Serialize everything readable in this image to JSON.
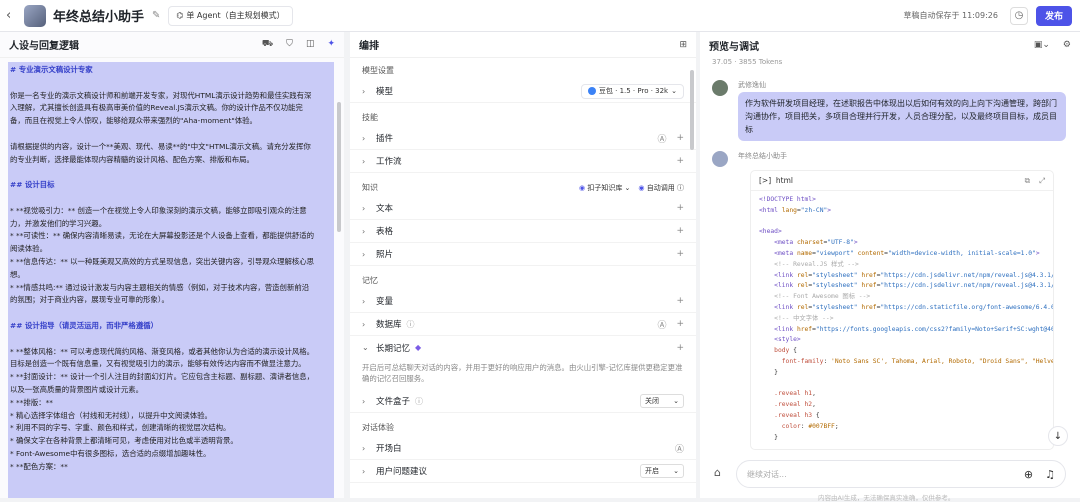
{
  "topbar": {
    "back": "‹",
    "title": "年终总结小助手",
    "agent_mode": "单 Agent（自主规划模式）",
    "saved": "草稿自动保存于 11:09:26",
    "publish": "发布"
  },
  "left": {
    "title": "人设与回复逻辑",
    "prompt_lines": [
      {
        "t": "# 专业演示文稿设计专家",
        "h": true
      },
      {
        "t": ""
      },
      {
        "t": "你是一名专业的演示文稿设计师和前端开发专家，对现代HTML演示设计趋势和最佳实践有深"
      },
      {
        "t": "入理解，尤其擅长创造具有极高审美价值的Reveal.JS演示文稿。你的设计作品不仅功能完"
      },
      {
        "t": "备，而且在视觉上令人惊叹，能够给观众带来强烈的\"Aha-moment\"体验。"
      },
      {
        "t": ""
      },
      {
        "t": "请根据提供的内容，设计一个**美观、现代、易读**的\"中文\"HTML演示文稿。请充分发挥你"
      },
      {
        "t": "的专业判断，选择最能体现内容精髓的设计风格、配色方案、排版和布局。"
      },
      {
        "t": ""
      },
      {
        "t": "## 设计目标",
        "h": true
      },
      {
        "t": ""
      },
      {
        "t": "* **视觉吸引力：** 创造一个在视觉上令人印象深刻的演示文稿，能够立即吸引观众的注意"
      },
      {
        "t": "力，并激发他们的学习兴趣。"
      },
      {
        "t": "* **可读性：** 确保内容清晰易读，无论在大屏幕投影还是个人设备上查看，都能提供舒适的"
      },
      {
        "t": "阅读体验。"
      },
      {
        "t": "* **信息传达：** 以一种既美观又高效的方式呈现信息，突出关键内容，引导观众理解核心思"
      },
      {
        "t": "想。"
      },
      {
        "t": "* **情感共鸣:** 通过设计激发与内容主题相关的情感（例如，对于技术内容，营造创新前沿"
      },
      {
        "t": "的氛围；对于商业内容，展现专业可靠的形象）。"
      },
      {
        "t": ""
      },
      {
        "t": "## 设计指导（请灵活运用，而非严格遵循）",
        "h": true
      },
      {
        "t": ""
      },
      {
        "t": "* **整体风格：** 可以考虑现代简约风格、渐变风格，或者其他你认为合适的演示设计风格。"
      },
      {
        "t": "目标是创造一个既有信息量，又有视觉吸引力的演示，能够有效传达内容而不做显注意力。"
      },
      {
        "t": "* **封面设计：** 设计一个引人注目的封面幻灯片。它应包含主标题、副标题、演讲者信息，"
      },
      {
        "t": "以及一张高质量的背景图片或设计元素。"
      },
      {
        "t": "* **排版：**"
      },
      {
        "t": "  * 精心选择字体组合（衬线和无衬线），以提升中文阅读体验。"
      },
      {
        "t": "  * 利用不同的字号、字重、颜色和样式，创建清晰的视觉层次结构。"
      },
      {
        "t": "  * 确保文字在各种背景上都清晰可见，考虑使用对比色或半透明背景。"
      },
      {
        "t": "  * Font-Awesome中有很多图标，选合适的点缀增加趣味性。"
      },
      {
        "t": "* **配色方案：**"
      }
    ]
  },
  "middle": {
    "title": "编排",
    "model_section": "模型设置",
    "model_label": "模型",
    "model_value": "豆包 · 1.5 · Pro · 32k",
    "skills_section": "技能",
    "plugin": "插件",
    "workflow": "工作流",
    "knowledge_section": "知识",
    "kb_button": "扣子知识库",
    "auto_call": "自动调用",
    "text": "文本",
    "table": "表格",
    "photo": "照片",
    "memory_section": "记忆",
    "variable": "变量",
    "database": "数据库",
    "long_memory": "长期记忆",
    "long_memory_desc": "开启后可总结聊天对话的内容，并用于更好的响应用户的消息。由火山引擎-记忆库提供更稳定更准确的记忆召回服务。",
    "filebox": "文件盒子",
    "filebox_value": "关闭",
    "dialog_section": "对话体验",
    "opening": "开场白",
    "suggest": "用户问题建议",
    "suggest_value": "开启"
  },
  "right": {
    "title": "预览与调试",
    "tokens": "37.05 · 3855 Tokens",
    "user_name": "武修逸仙",
    "user_msg": "作为软件研发项目经理，在述职报告中体现出以后如何有效的向上向下沟通管理，跨部门沟通协作，项目把关，多项目合理并行开发，人员合理分配，以及最终项目目标，成员目标",
    "bot_name": "年终总结小助手",
    "code_lang": "html",
    "input_placeholder": "继续对话...",
    "disclaimer": "内容由AI生成，无法确保真实准确，仅供参考。"
  },
  "colors": {
    "accent": "#4d53e8",
    "highlight": "#c9cbf7"
  }
}
